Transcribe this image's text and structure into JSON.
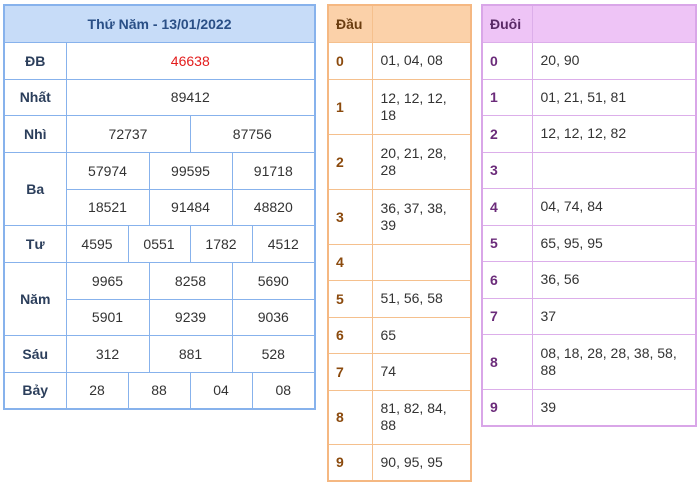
{
  "results": {
    "title": "Thứ Năm - 13/01/2022",
    "special_label": "ĐB",
    "special": "46638",
    "first_label": "Nhất",
    "first": "89412",
    "second_label": "Nhì",
    "second": [
      "72737",
      "87756"
    ],
    "third_label": "Ba",
    "third": [
      "57974",
      "99595",
      "91718",
      "18521",
      "91484",
      "48820"
    ],
    "fourth_label": "Tư",
    "fourth": [
      "4595",
      "0551",
      "1782",
      "4512"
    ],
    "fifth_label": "Năm",
    "fifth": [
      "9965",
      "8258",
      "5690",
      "5901",
      "9239",
      "9036"
    ],
    "sixth_label": "Sáu",
    "sixth": [
      "312",
      "881",
      "528"
    ],
    "seventh_label": "Bảy",
    "seventh": [
      "28",
      "88",
      "04",
      "08"
    ]
  },
  "head": {
    "title": "Đầu",
    "rows": [
      {
        "key": "0",
        "value": "01, 04, 08"
      },
      {
        "key": "1",
        "value": "12, 12, 12, 18"
      },
      {
        "key": "2",
        "value": "20, 21, 28, 28"
      },
      {
        "key": "3",
        "value": "36, 37, 38, 39"
      },
      {
        "key": "4",
        "value": ""
      },
      {
        "key": "5",
        "value": "51, 56, 58"
      },
      {
        "key": "6",
        "value": "65"
      },
      {
        "key": "7",
        "value": "74"
      },
      {
        "key": "8",
        "value": "81, 82, 84, 88"
      },
      {
        "key": "9",
        "value": "90, 95, 95"
      }
    ]
  },
  "tail": {
    "title": "Đuôi",
    "rows": [
      {
        "key": "0",
        "value": "20, 90"
      },
      {
        "key": "1",
        "value": "01, 21, 51, 81"
      },
      {
        "key": "2",
        "value": "12, 12, 12, 82"
      },
      {
        "key": "3",
        "value": ""
      },
      {
        "key": "4",
        "value": "04, 74, 84"
      },
      {
        "key": "5",
        "value": "65, 95, 95"
      },
      {
        "key": "6",
        "value": "36, 56"
      },
      {
        "key": "7",
        "value": "37"
      },
      {
        "key": "8",
        "value": "08, 18, 28, 28, 38, 58, 88"
      },
      {
        "key": "9",
        "value": "39"
      }
    ]
  }
}
